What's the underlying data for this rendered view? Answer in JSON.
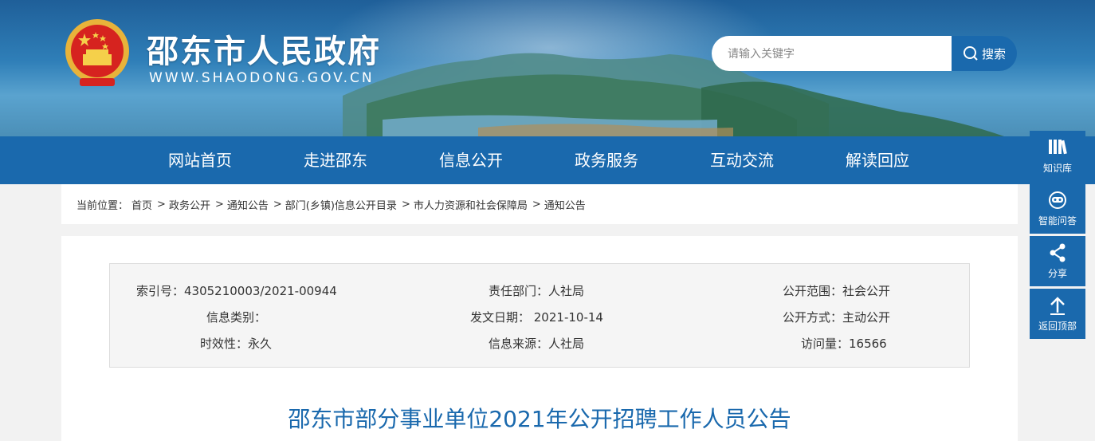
{
  "header": {
    "site_title": "邵东市人民政府",
    "site_url": "WWW.SHAODONG.GOV.CN",
    "search_placeholder": "请输入关键字",
    "search_button": "搜索"
  },
  "nav": {
    "items": [
      "网站首页",
      "走进邵东",
      "信息公开",
      "政务服务",
      "互动交流",
      "解读回应"
    ]
  },
  "breadcrumb": {
    "prefix": "当前位置：",
    "items": [
      "首页",
      "政务公开",
      "通知公告",
      "部门(乡镇)信息公开目录",
      "市人力资源和社会保障局",
      "通知公告"
    ]
  },
  "meta": {
    "index_no": "索引号：4305210003/2021-00944",
    "department": "责任部门：人社局",
    "scope": "公开范围：社会公开",
    "category": "信息类别：",
    "issue_date": "发文日期： 2021-10-14",
    "mode": "公开方式：主动公开",
    "validity": "时效性：永久",
    "source": "信息来源：人社局",
    "visits": "访问量：16566"
  },
  "article": {
    "title": "邵东市部分事业单位2021年公开招聘工作人员公告"
  },
  "float_bar": {
    "knowledge": "知识库",
    "qa": "智能问答",
    "share": "分享",
    "top": "返回顶部"
  },
  "colors": {
    "primary": "#1a69ad",
    "title_blue": "#1a69ad"
  }
}
